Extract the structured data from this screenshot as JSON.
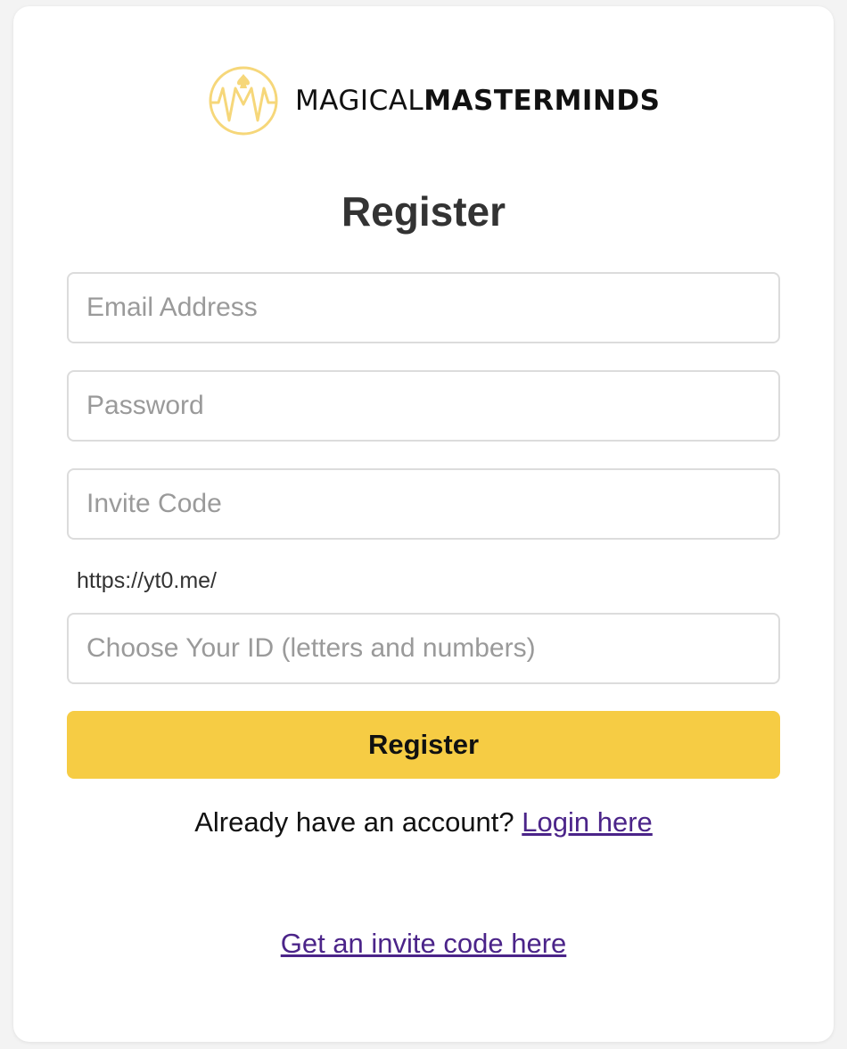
{
  "brand": {
    "name_light": "MAGICAL",
    "name_bold": "MASTERMINDS",
    "accent_color": "#f6cc44",
    "logo_icon": "mm-logo-icon"
  },
  "form": {
    "title": "Register",
    "email_placeholder": "Email Address",
    "password_placeholder": "Password",
    "invite_placeholder": "Invite Code",
    "url_prefix": "https://yt0.me/",
    "id_placeholder": "Choose Your ID (letters and numbers)",
    "submit_label": "Register"
  },
  "footer": {
    "login_prompt": "Already have an account? ",
    "login_link": "Login here",
    "invite_link": "Get an invite code here",
    "link_color": "#4b2489"
  }
}
